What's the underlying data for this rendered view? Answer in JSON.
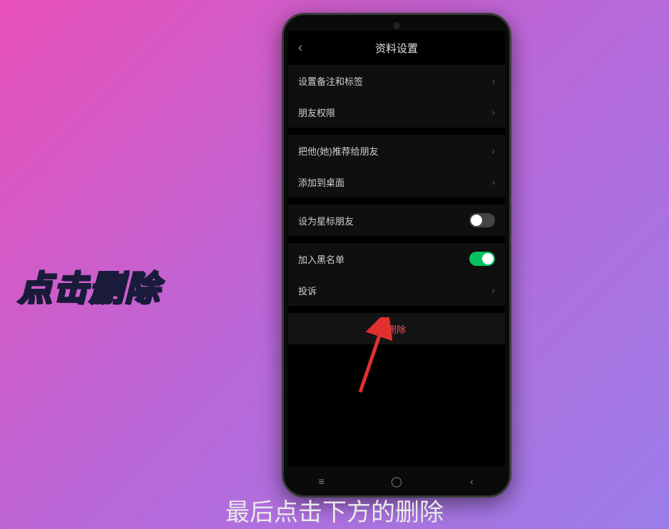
{
  "side_caption": "点击删除",
  "bottom_caption": "最后点击下方的删除",
  "header": {
    "title": "资料设置"
  },
  "items": {
    "remark": "设置备注和标签",
    "permission": "朋友权限",
    "recommend": "把他(她)推荐给朋友",
    "add_desktop": "添加到桌面",
    "star": "设为星标朋友",
    "blacklist": "加入黑名单",
    "report": "投诉",
    "delete": "删除"
  },
  "nav": {
    "recent": "≡",
    "home": "◯",
    "back": "‹"
  }
}
